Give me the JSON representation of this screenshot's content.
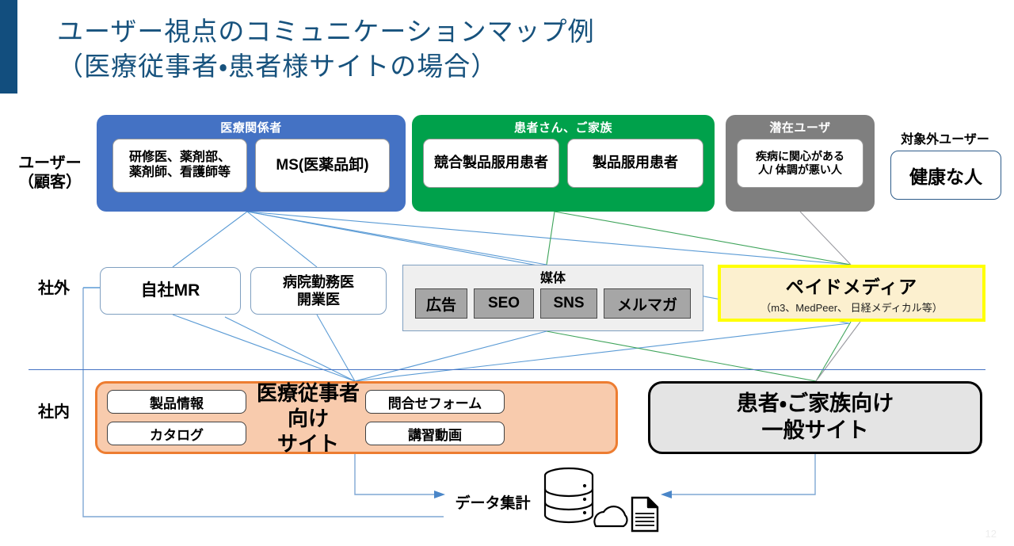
{
  "slide": {
    "title": "ユーザー視点のコミュニケーションマップ例\n（医療従事者・患者様サイトの場合）",
    "page_number": "12",
    "accent_color": "#124E7E",
    "title_color": "#17527D"
  },
  "row_labels": {
    "user": "ユーザー\n（顧客）",
    "external": "社外",
    "internal": "社内"
  },
  "user_groups": [
    {
      "id": "medical",
      "title": "医療関係者",
      "color": "#4472C4",
      "items": [
        "研修医、薬剤部、\n薬剤師、看護師等",
        "MS(医薬品卸)"
      ]
    },
    {
      "id": "patient",
      "title": "患者さん、ご家族",
      "color": "#00A14B",
      "items": [
        "競合製品服用患者",
        "製品服用患者"
      ]
    },
    {
      "id": "latent",
      "title": "潜在ユーザ",
      "color": "#7F7F7F",
      "items": [
        "疾病に関心がある\n人/ 体調が悪い人"
      ]
    }
  ],
  "out_of_target": {
    "label": "対象外ユーザー",
    "box": "健康な人"
  },
  "external_row": {
    "own_mr": "自社MR",
    "hospital_doctor": "病院勤務医\n開業医",
    "media": {
      "title": "媒体",
      "channels": [
        "広告",
        "SEO",
        "SNS",
        "メルマガ"
      ]
    },
    "paid_media": {
      "title": "ペイドメディア",
      "subtitle": "（m3、MedPeer、 日経メディカル等）",
      "border_color": "#FFFF00",
      "fill_color": "#FCF0CF"
    }
  },
  "internal_row": {
    "hcp_site": {
      "title": "医療従事者向け\nサイト",
      "left_items": [
        "製品情報",
        "カタログ"
      ],
      "right_items": [
        "問合せフォーム",
        "講習動画"
      ],
      "border_color": "#ED7D31",
      "fill_color": "#F8CBAD"
    },
    "public_site": {
      "title": "患者・ご家族向け\n一般サイト",
      "fill_color": "#E4E4E4"
    }
  },
  "data_aggregation": {
    "label": "データ集計",
    "icons": [
      "database-icon",
      "cloud-icon",
      "document-icon"
    ]
  }
}
